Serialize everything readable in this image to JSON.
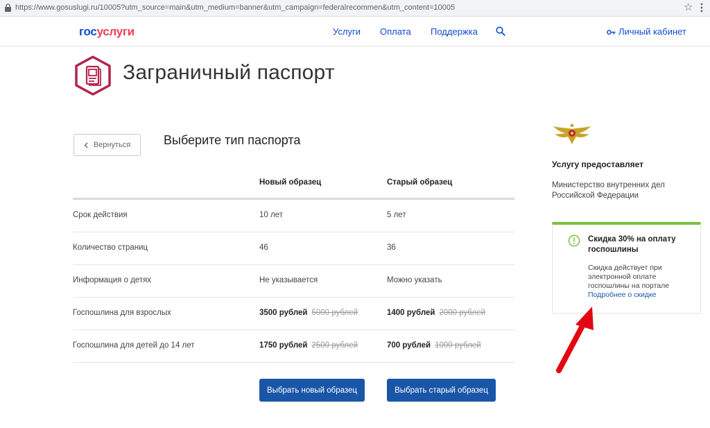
{
  "browser": {
    "url": "https://www.gosuslugi.ru/10005?utm_source=main&utm_medium=banner&utm_campaign=federalrecommen&utm_content=10005"
  },
  "header": {
    "logo_part1": "гос",
    "logo_part2": "услуги",
    "nav": [
      "Услуги",
      "Оплата",
      "Поддержка"
    ],
    "cabinet": "Личный кабинет"
  },
  "page": {
    "title": "Заграничный паспорт",
    "back_label": "Вернуться",
    "section_title": "Выберите тип паспорта"
  },
  "table": {
    "columns": [
      "",
      "Новый образец",
      "Старый образец"
    ],
    "rows": [
      {
        "label": "Срок действия",
        "new": "10 лет",
        "old": "5 лет"
      },
      {
        "label": "Количество страниц",
        "new": "46",
        "old": "36"
      },
      {
        "label": "Информация о детях",
        "new": "Не указывается",
        "old": "Можно указать"
      },
      {
        "label": "Госпошлина для взрослых",
        "new_price": "3500 рублей",
        "new_old_price": "5000 рублей",
        "old_price": "1400 рублей",
        "old_old_price": "2000 рублей"
      },
      {
        "label": "Госпошлина для детей до 14 лет",
        "new_price": "1750 рублей",
        "new_old_price": "2500 рублей",
        "old_price": "700 рублей",
        "old_old_price": "1000 рублей"
      }
    ]
  },
  "buttons": {
    "choose_new": "Выбрать новый образец",
    "choose_old": "Выбрать старый образец"
  },
  "sidebar": {
    "provider_label": "Услугу предоставляет",
    "provider_name": "Министерство внутренних дел Российской Федерации",
    "promo_title": "Скидка 30% на оплату госпошлины",
    "promo_text": "Скидка действует при электронной оплате госпошлины на портале",
    "promo_link": "Подробнее о скидке"
  },
  "colors": {
    "brand_blue": "#0d4cd3",
    "brand_red": "#ee3f58",
    "button_blue": "#1a56a8",
    "promo_green": "#7cbf42",
    "annotation_arrow": "#e30613"
  },
  "icons": [
    "lock-icon",
    "star-icon",
    "menu-dots-icon",
    "search-icon",
    "key-icon",
    "passport-icon",
    "chevron-left-icon",
    "emblem-icon",
    "info-icon",
    "arrow-annotation-icon"
  ]
}
